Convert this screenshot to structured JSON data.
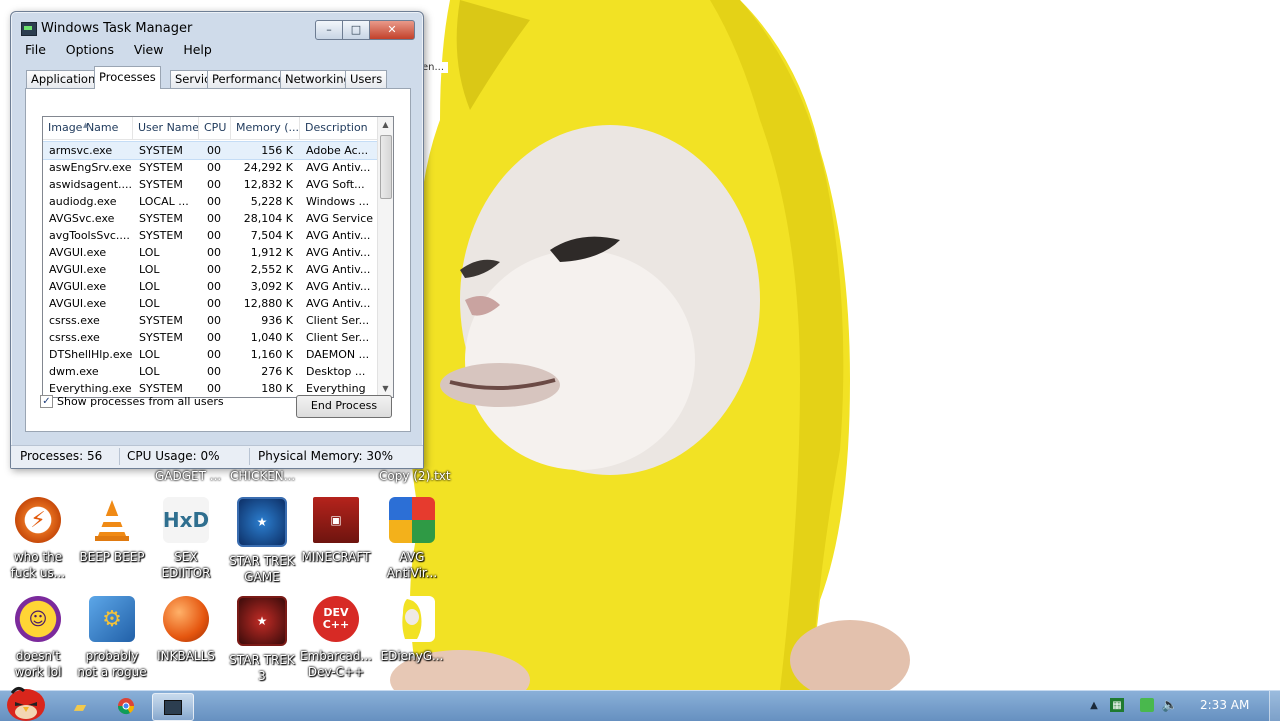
{
  "window": {
    "title": "Windows Task Manager",
    "controls": {
      "minimize": "–",
      "maximize": "□",
      "close": "✕"
    },
    "menu": [
      "File",
      "Options",
      "View",
      "Help"
    ],
    "tabs": [
      "Applications",
      "Processes",
      "Services",
      "Performance",
      "Networking",
      "Users"
    ],
    "active_tab": "Processes"
  },
  "process_list": {
    "columns": [
      "Image Name",
      "User Name",
      "CPU",
      "Memory (...",
      "Description"
    ],
    "rows": [
      {
        "image": "armsvc.exe",
        "user": "SYSTEM",
        "cpu": "00",
        "mem": "156 K",
        "desc": "Adobe Ac..."
      },
      {
        "image": "aswEngSrv.exe",
        "user": "SYSTEM",
        "cpu": "00",
        "mem": "24,292 K",
        "desc": "AVG Antiv..."
      },
      {
        "image": "aswidsagent....",
        "user": "SYSTEM",
        "cpu": "00",
        "mem": "12,832 K",
        "desc": "AVG Soft..."
      },
      {
        "image": "audiodg.exe",
        "user": "LOCAL ...",
        "cpu": "00",
        "mem": "5,228 K",
        "desc": "Windows ..."
      },
      {
        "image": "AVGSvc.exe",
        "user": "SYSTEM",
        "cpu": "00",
        "mem": "28,104 K",
        "desc": "AVG Service"
      },
      {
        "image": "avgToolsSvc....",
        "user": "SYSTEM",
        "cpu": "00",
        "mem": "7,504 K",
        "desc": "AVG Antiv..."
      },
      {
        "image": "AVGUI.exe",
        "user": "LOL",
        "cpu": "00",
        "mem": "1,912 K",
        "desc": "AVG Antiv..."
      },
      {
        "image": "AVGUI.exe",
        "user": "LOL",
        "cpu": "00",
        "mem": "2,552 K",
        "desc": "AVG Antiv..."
      },
      {
        "image": "AVGUI.exe",
        "user": "LOL",
        "cpu": "00",
        "mem": "3,092 K",
        "desc": "AVG Antiv..."
      },
      {
        "image": "AVGUI.exe",
        "user": "LOL",
        "cpu": "00",
        "mem": "12,880 K",
        "desc": "AVG Antiv..."
      },
      {
        "image": "csrss.exe",
        "user": "SYSTEM",
        "cpu": "00",
        "mem": "936 K",
        "desc": "Client Ser..."
      },
      {
        "image": "csrss.exe",
        "user": "SYSTEM",
        "cpu": "00",
        "mem": "1,040 K",
        "desc": "Client Ser..."
      },
      {
        "image": "DTShellHlp.exe",
        "user": "LOL",
        "cpu": "00",
        "mem": "1,160 K",
        "desc": "DAEMON ..."
      },
      {
        "image": "dwm.exe",
        "user": "LOL",
        "cpu": "00",
        "mem": "276 K",
        "desc": "Desktop ..."
      },
      {
        "image": "Everything.exe",
        "user": "SYSTEM",
        "cpu": "00",
        "mem": "180 K",
        "desc": "Everything"
      }
    ],
    "selected_index": 0
  },
  "show_all_users": {
    "label": "Show processes from all users",
    "checked": true
  },
  "end_process_label": "End Process",
  "status": {
    "processes": "Processes: 56",
    "cpu": "CPU Usage: 0%",
    "memory": "Physical Memory: 30%"
  },
  "desktop": {
    "partial_labels": [
      "GADGET ...",
      "CHICKEN...",
      "Copy (2).txt"
    ],
    "icons_row1": [
      {
        "label1": "who the",
        "label2": "fuck us...",
        "icon": "lightning-app-icon"
      },
      {
        "label1": "BEEP BEEP",
        "label2": "",
        "icon": "vlc-cone-icon"
      },
      {
        "label1": "SEX",
        "label2": "EDIITOR",
        "icon": "hxd-editor-icon"
      },
      {
        "label1": "STAR TREK",
        "label2": "GAME",
        "icon": "star-trek-game-icon"
      },
      {
        "label1": "MINECRAFT",
        "label2": "",
        "icon": "minecraft-icon"
      },
      {
        "label1": "AVG",
        "label2": "AntiVir...",
        "icon": "avg-antivirus-icon"
      }
    ],
    "icons_row2": [
      {
        "label1": "doesn't",
        "label2": "work lol",
        "icon": "yahoo-messenger-icon"
      },
      {
        "label1": "probably",
        "label2": "not a rogue",
        "icon": "software-box-icon"
      },
      {
        "label1": "INKBALLS",
        "label2": "",
        "icon": "inkball-icon"
      },
      {
        "label1": "STAR TREK",
        "label2": "3",
        "icon": "star-wars-icon"
      },
      {
        "label1": "Embarcad...",
        "label2": "Dev-C++",
        "icon": "dev-cpp-icon"
      },
      {
        "label1": "EDienyG...",
        "label2": "",
        "icon": "banana-icon"
      }
    ]
  },
  "taskbar": {
    "clock": "2:33 AM"
  }
}
